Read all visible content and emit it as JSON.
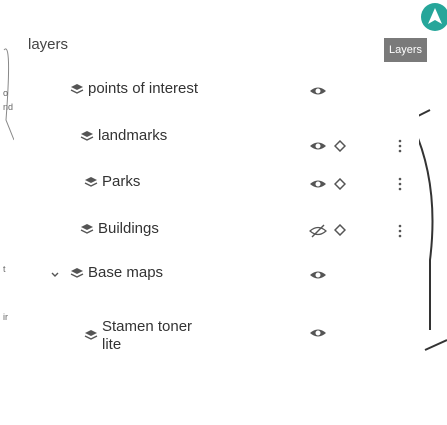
{
  "panel": {
    "title": "layers"
  },
  "layers": [
    {
      "id": "poi",
      "label": "points of interest",
      "eye": "visible",
      "reorder": false,
      "menu": false
    },
    {
      "id": "landmarks",
      "label": "landmarks",
      "eye": "visible",
      "reorder": true,
      "menu": true
    },
    {
      "id": "parks",
      "label": "Parks",
      "eye": "visible",
      "reorder": true,
      "menu": true
    },
    {
      "id": "buildings",
      "label": "Buildings",
      "eye": "hidden",
      "reorder": true,
      "menu": true
    },
    {
      "id": "basemaps",
      "label": "Base maps",
      "eye": "visible",
      "reorder": false,
      "menu": false,
      "expand": "collapse"
    },
    {
      "id": "stamen",
      "label_line1": "Stamen toner",
      "label_line2": "lite",
      "eye": "visible",
      "reorder": false,
      "menu": false
    }
  ],
  "button": {
    "label": "Layers"
  },
  "colors": {
    "accent": "#26a69a",
    "button_bg": "#7a7a7a",
    "icon": "#555555"
  }
}
